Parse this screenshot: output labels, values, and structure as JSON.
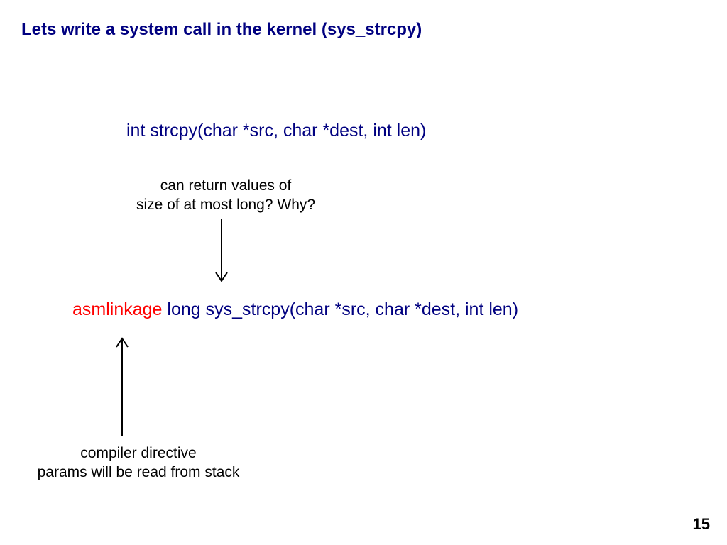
{
  "title": "Lets write a system call in the kernel (sys_strcpy)",
  "signature": "int strcpy(char *src, char *dest, int len)",
  "annotation_top_line1": "can return values of",
  "annotation_top_line2": "size of at most long? Why?",
  "syscall_red": "asmlinkage",
  "syscall_rest": " long sys_strcpy(char *src, char *dest, int len)",
  "annotation_bottom_line1": "compiler directive",
  "annotation_bottom_line2": "params will be read from stack",
  "page_number": "15"
}
